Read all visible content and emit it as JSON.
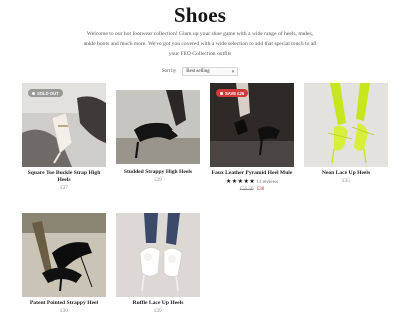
{
  "page": {
    "title": "Shoes",
    "intro": "Welcome to our hot footwear collection! Glam up your shoe game with a wide range of heels, mules, ankle boots and much more. We've got you covered with a wide selection to add that special touch to all your FEO Collection outfits",
    "sort_label": "Sort by",
    "sort_value": "Best selling"
  },
  "products": [
    {
      "name": "Square Toe Buckle Strap High Heels",
      "price": "£37",
      "badge": "SOLD OUT",
      "badge_icon": "circle-dot-icon"
    },
    {
      "name": "Studded Strappy High Heels",
      "price": "£39"
    },
    {
      "name": "Faux Leather Pyramid Heel Mule",
      "old_price": "£55.56",
      "new_price": "£30",
      "badge": "SAVE £25",
      "badge_icon": "tag-icon",
      "stars": "★★★★★",
      "reviews": "11 reviews"
    },
    {
      "name": "Neon Lace Up Heels",
      "price": "£35"
    },
    {
      "name": "Patent Pointed Strappy Heel",
      "price": "£30"
    },
    {
      "name": "Ruffle Lace Up Heels",
      "price": "£39"
    }
  ],
  "colors": {
    "sale_badge": "#d23a3a",
    "soldout_badge": "#8c8c8c",
    "accent_neon": "#c8e61e"
  }
}
